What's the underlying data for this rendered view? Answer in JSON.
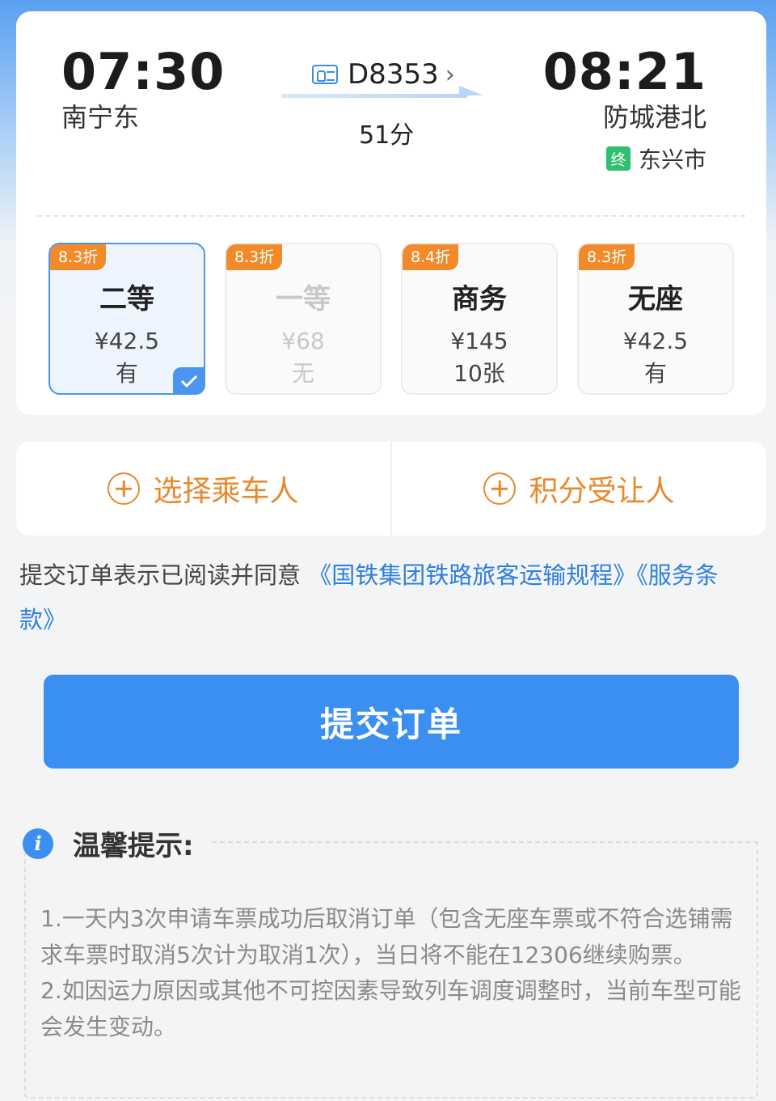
{
  "train": {
    "departure_time": "07:30",
    "departure_station": "南宁东",
    "arrival_time": "08:21",
    "arrival_station": "防城港北",
    "terminal_tag": "终",
    "terminal_station": "东兴市",
    "train_number": "D8353",
    "duration": "51分"
  },
  "seats": [
    {
      "discount": "8.3折",
      "name": "二等",
      "price": "¥42.5",
      "availability": "有",
      "selected": true
    },
    {
      "discount": "8.3折",
      "name": "一等",
      "price": "¥68",
      "availability": "无",
      "disabled": true
    },
    {
      "discount": "8.4折",
      "name": "商务",
      "price": "¥145",
      "availability": "10张"
    },
    {
      "discount": "8.3折",
      "name": "无座",
      "price": "¥42.5",
      "availability": "有"
    }
  ],
  "actions": {
    "select_passenger": "选择乘车人",
    "points_beneficiary": "积分受让人"
  },
  "agreement": {
    "prefix": "提交订单表示已阅读并同意 ",
    "link1": "《国铁集团铁路旅客运输规程》",
    "link2": "《服务条款》"
  },
  "submit_label": "提交订单",
  "tips": {
    "title": "温馨提示:",
    "item1": "1.一天内3次申请车票成功后取消订单（包含无座车票或不符合选铺需求车票时取消5次计为取消1次），当日将不能在12306继续购票。",
    "item2": "2.如因运力原因或其他不可控因素导致列车调度调整时，当前车型可能会发生变动。"
  },
  "colors": {
    "accent_blue": "#3b8ff0",
    "discount_orange": "#f38a2a",
    "action_orange": "#e8892c",
    "terminal_green": "#2fbf71"
  }
}
